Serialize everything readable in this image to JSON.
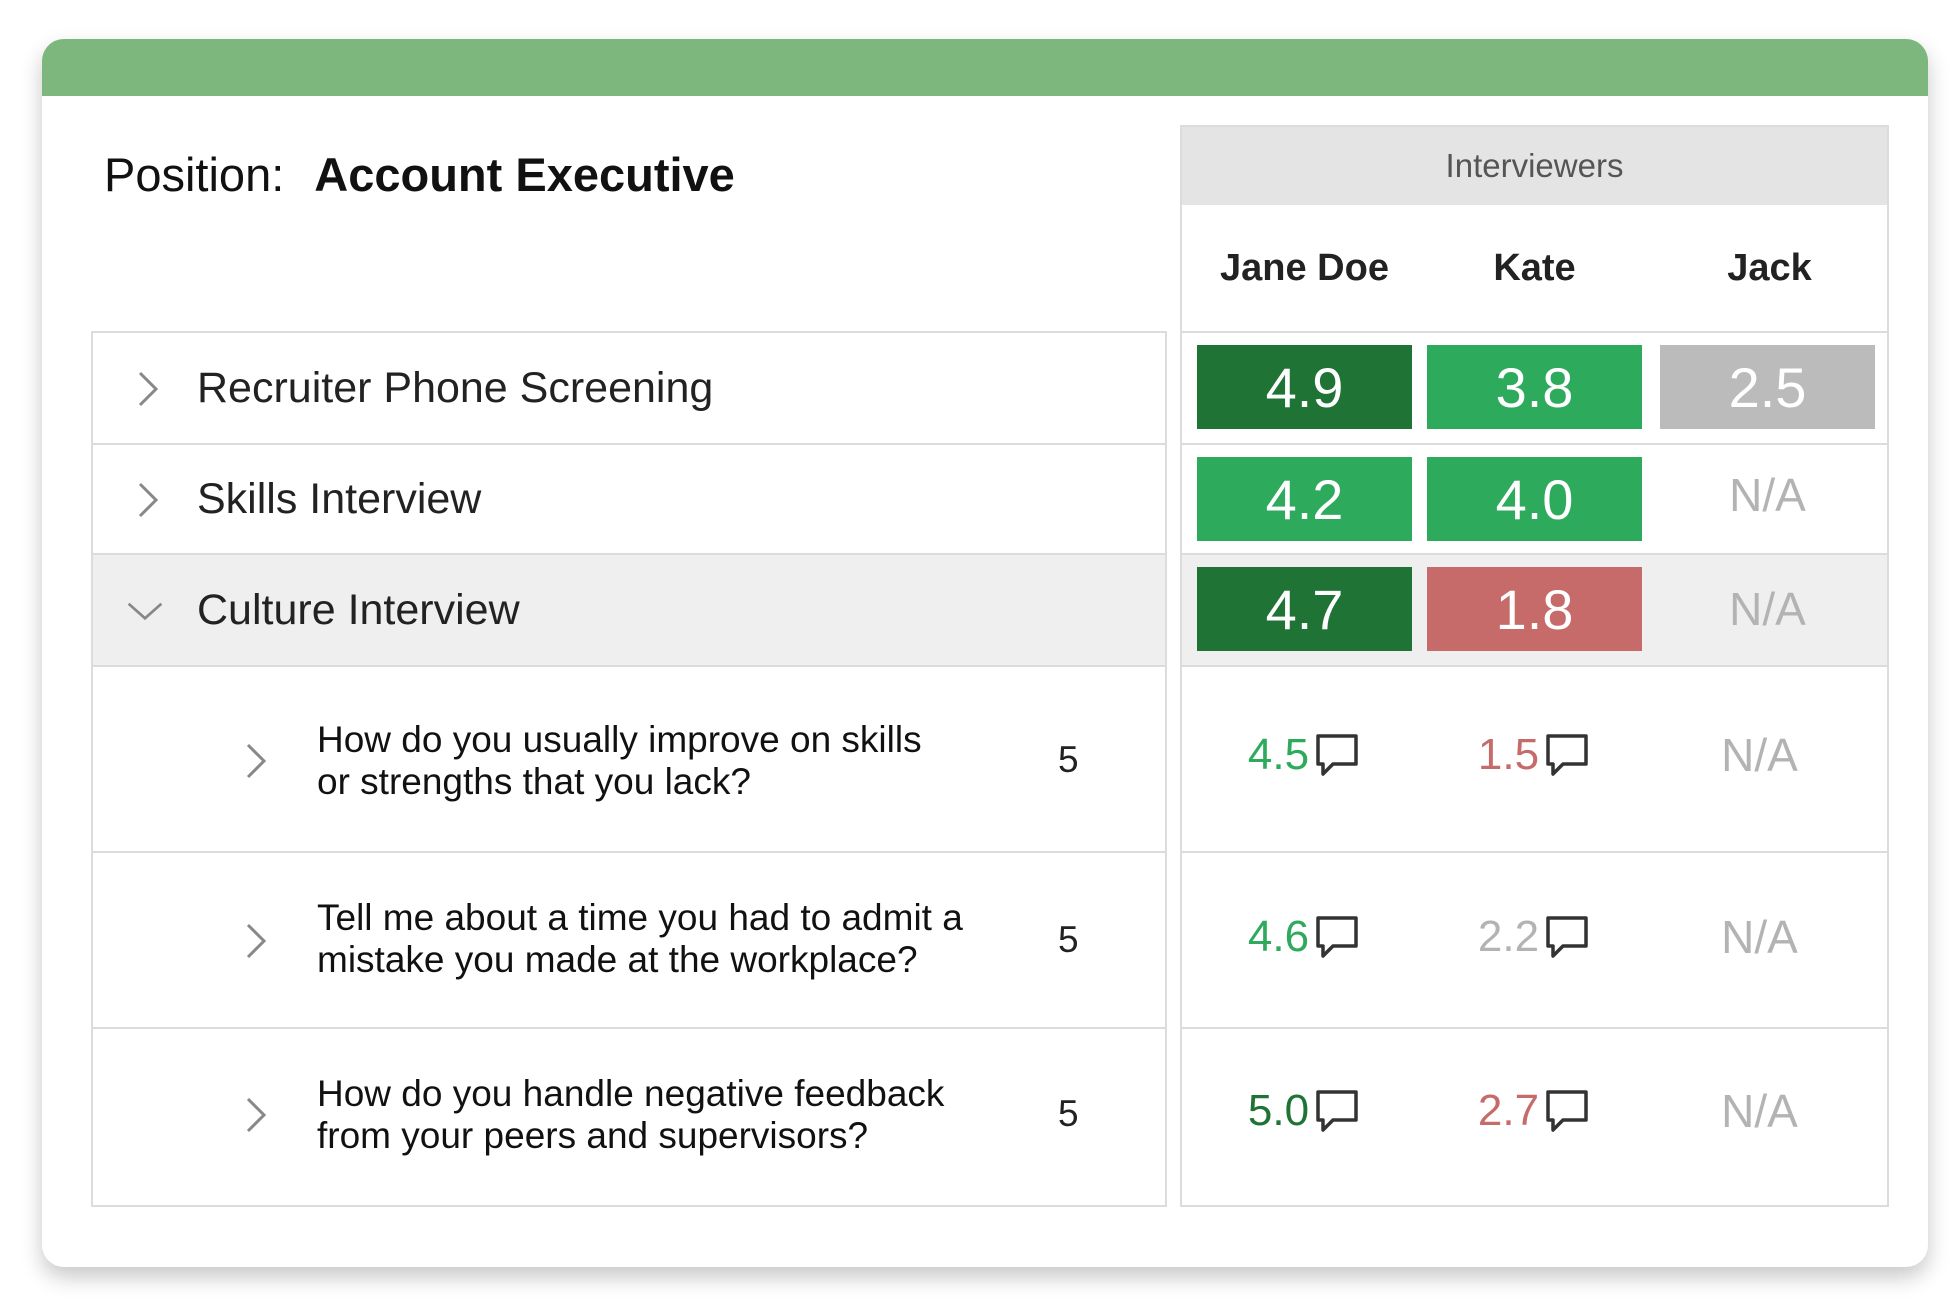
{
  "position": {
    "label": "Position:",
    "value": "Account Executive"
  },
  "interviewers": {
    "header": "Interviewers",
    "names": [
      "Jane Doe",
      "Kate",
      "Jack"
    ]
  },
  "icons": {
    "expand": "chevron-right-icon",
    "collapse": "chevron-down-icon",
    "comment": "comment-icon"
  },
  "colors": {
    "dark_green": "#1e7335",
    "green": "#2eaa5d",
    "gray": "#bbbbbb",
    "red": "#c76a6a",
    "na": "#b3b3b3"
  },
  "stages": [
    {
      "label": "Recruiter Phone Screening",
      "expanded": false,
      "scores": [
        {
          "value": "4.9",
          "color": "#1e7335"
        },
        {
          "value": "3.8",
          "color": "#2eaa5d"
        },
        {
          "value": "2.5",
          "color": "#bbbbbb"
        }
      ]
    },
    {
      "label": "Skills Interview",
      "expanded": false,
      "scores": [
        {
          "value": "4.2",
          "color": "#2eaa5d"
        },
        {
          "value": "4.0",
          "color": "#2eaa5d"
        },
        {
          "value": "N/A",
          "color": null
        }
      ]
    },
    {
      "label": "Culture Interview",
      "expanded": true,
      "scores": [
        {
          "value": "4.7",
          "color": "#1e7335"
        },
        {
          "value": "1.8",
          "color": "#c76a6a"
        },
        {
          "value": "N/A",
          "color": null
        }
      ]
    }
  ],
  "questions": [
    {
      "line1": "How do you usually improve on skills",
      "line2": "or strengths that you lack?",
      "max": "5",
      "scores": [
        {
          "value": "4.5",
          "color": "#2eaa5d"
        },
        {
          "value": "1.5",
          "color": "#c76a6a"
        },
        {
          "value": "N/A",
          "color": "#b3b3b3"
        }
      ]
    },
    {
      "line1": "Tell me about a time you had to admit a",
      "line2": "mistake you made at the workplace?",
      "max": "5",
      "scores": [
        {
          "value": "4.6",
          "color": "#2eaa5d"
        },
        {
          "value": "2.2",
          "color": "#b3b3b3"
        },
        {
          "value": "N/A",
          "color": "#b3b3b3"
        }
      ]
    },
    {
      "line1": "How do you handle negative feedback",
      "line2": "from your peers and supervisors?",
      "max": "5",
      "scores": [
        {
          "value": "5.0",
          "color": "#1e7335"
        },
        {
          "value": "2.7",
          "color": "#c76a6a"
        },
        {
          "value": "N/A",
          "color": "#b3b3b3"
        }
      ]
    }
  ]
}
